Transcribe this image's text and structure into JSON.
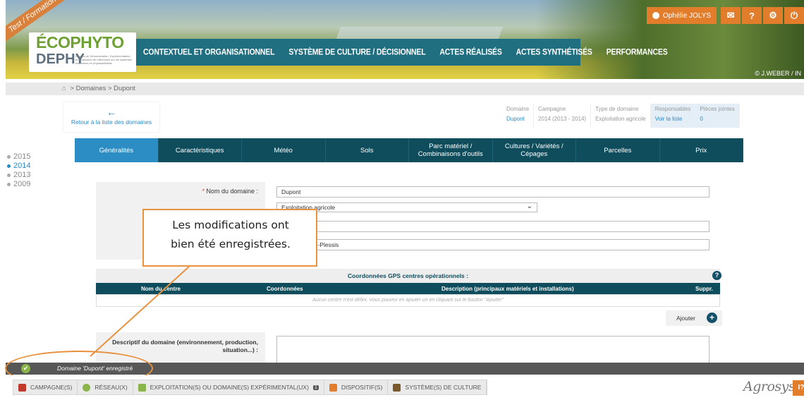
{
  "header": {
    "env_ribbon": "Test / Formation",
    "logo_line1": "ÉCOPHYTO",
    "logo_line2": "DEPHY",
    "logo_tagline": "Réseau de Démonstration, Expérimentation et Production de références sur les systèmes économes en phytosanitaires",
    "nav": [
      "CONTEXTUEL ET ORGANISATIONNEL",
      "SYSTÈME DE CULTURE / DÉCISIONNEL",
      "ACTES RÉALISÉS",
      "ACTES SYNTHÉTISÉS",
      "PERFORMANCES"
    ],
    "user_name": "Ophélie JOLYS",
    "photo_credit": "© J.WEBER / IN"
  },
  "breadcrumb": {
    "text": "> Domaines  > Dupont"
  },
  "campaigns": [
    "2015",
    "2014",
    "2013",
    "2009"
  ],
  "active_campaign": "2014",
  "back_link": "Retour à la liste des domaines",
  "info": {
    "domaine_label": "Domaine",
    "domaine_value": "Dupont",
    "campagne_label": "Campagne",
    "campagne_value": "2014 (2013 - 2014)",
    "type_label": "Type de domaine",
    "type_value": "Exploitation agricole",
    "responsables_label": "Responsables",
    "responsables_value": "Voir la liste",
    "pieces_label": "Pièces jointes",
    "pieces_value": "0"
  },
  "tabs": [
    "Généralités",
    "Caractéristiques",
    "Météo",
    "Sols",
    "Parc matériel / Combinaisons d'outils",
    "Cultures / Variétés / Cépages",
    "Parcelles",
    "Prix"
  ],
  "form": {
    "nom_label": "Nom du domaine :",
    "nom_value": "Dupont",
    "type_value": "Exploitation agricole",
    "commune_value_partial": "du-Plessis"
  },
  "gps": {
    "title": "Coordonnées GPS centres opérationnels :",
    "columns": [
      "Nom du centre",
      "Coordonnées",
      "Description (principaux matériels et installations)",
      "Suppr."
    ],
    "empty": "Aucun centre n'est défini. Vous pouvez en ajouter un en cliquant sur le bouton \"Ajouter\"",
    "add_label": "Ajouter"
  },
  "description_label": "Descriptif du domaine (environnement, production, situation...) :",
  "callout": {
    "line1": "Les modifications ont",
    "line2": "bien été enregistrées."
  },
  "notification": "Domaine 'Dupont' enregistré",
  "bottom_nav": [
    {
      "label": "CAMPAGNE(S)",
      "icon": "calendar-icon",
      "color": "#c0392b"
    },
    {
      "label": "RÉSEAU(X)",
      "icon": "network-icon",
      "color": "#8ab548"
    },
    {
      "label": "EXPLOITATION(S) OU DOMAINE(S) EXPÉRIMENTAL(UX)",
      "icon": "farm-icon",
      "color": "#8ab548",
      "badge": "1"
    },
    {
      "label": "DISPOSITIF(S)",
      "icon": "device-icon",
      "color": "#e27d2c"
    },
    {
      "label": "SYSTÈME(S) DE CULTURE",
      "icon": "wheat-icon",
      "color": "#7a5a2b"
    }
  ],
  "brand": "Agrosyst",
  "help_chip": "I?",
  "colors": {
    "accent": "#e27d2c",
    "tab_bg": "#0f4d5c",
    "tab_active": "#2b8dc4",
    "callout_border": "#e8913f"
  }
}
